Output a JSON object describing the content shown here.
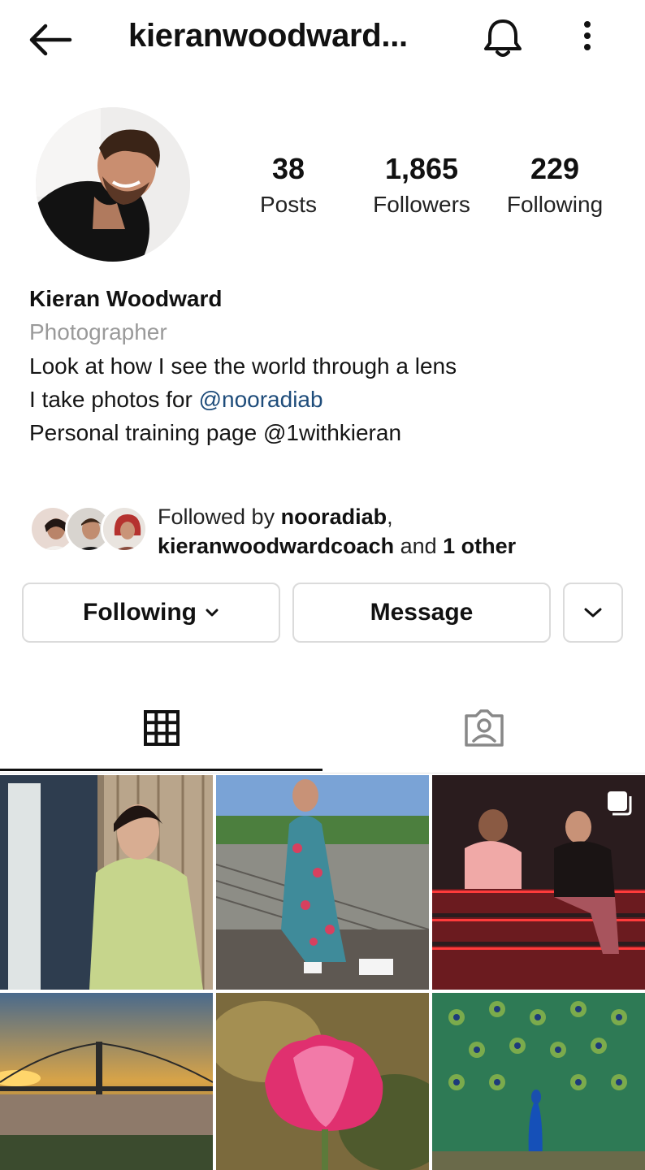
{
  "header": {
    "title": "kieranwoodward...",
    "back_icon": "arrow-left-icon",
    "bell_icon": "bell-icon",
    "more_icon": "more-vertical-icon"
  },
  "stats": {
    "posts": {
      "value": "38",
      "label": "Posts"
    },
    "followers": {
      "value": "1,865",
      "label": "Followers"
    },
    "following": {
      "value": "229",
      "label": "Following"
    }
  },
  "bio": {
    "name": "Kieran Woodward",
    "category": "Photographer",
    "line1": "Look at how I see the world through a lens",
    "line2_prefix": "I take photos for ",
    "line2_mention": "@nooradiab",
    "line3": "Personal training page @1withkieran"
  },
  "followed_by": {
    "prefix": "Followed by ",
    "user1": "nooradiab",
    "sep": ",",
    "user2": "kieranwoodwardcoach",
    "and": " and ",
    "others": "1 other"
  },
  "actions": {
    "following_label": "Following",
    "message_label": "Message"
  },
  "tabs": {
    "grid_icon": "grid-icon",
    "tagged_icon": "tagged-person-icon",
    "active": "grid"
  },
  "colors": {
    "mention": "#1e4c7a",
    "muted": "#9a9a9a",
    "border": "#dbdbdb"
  }
}
